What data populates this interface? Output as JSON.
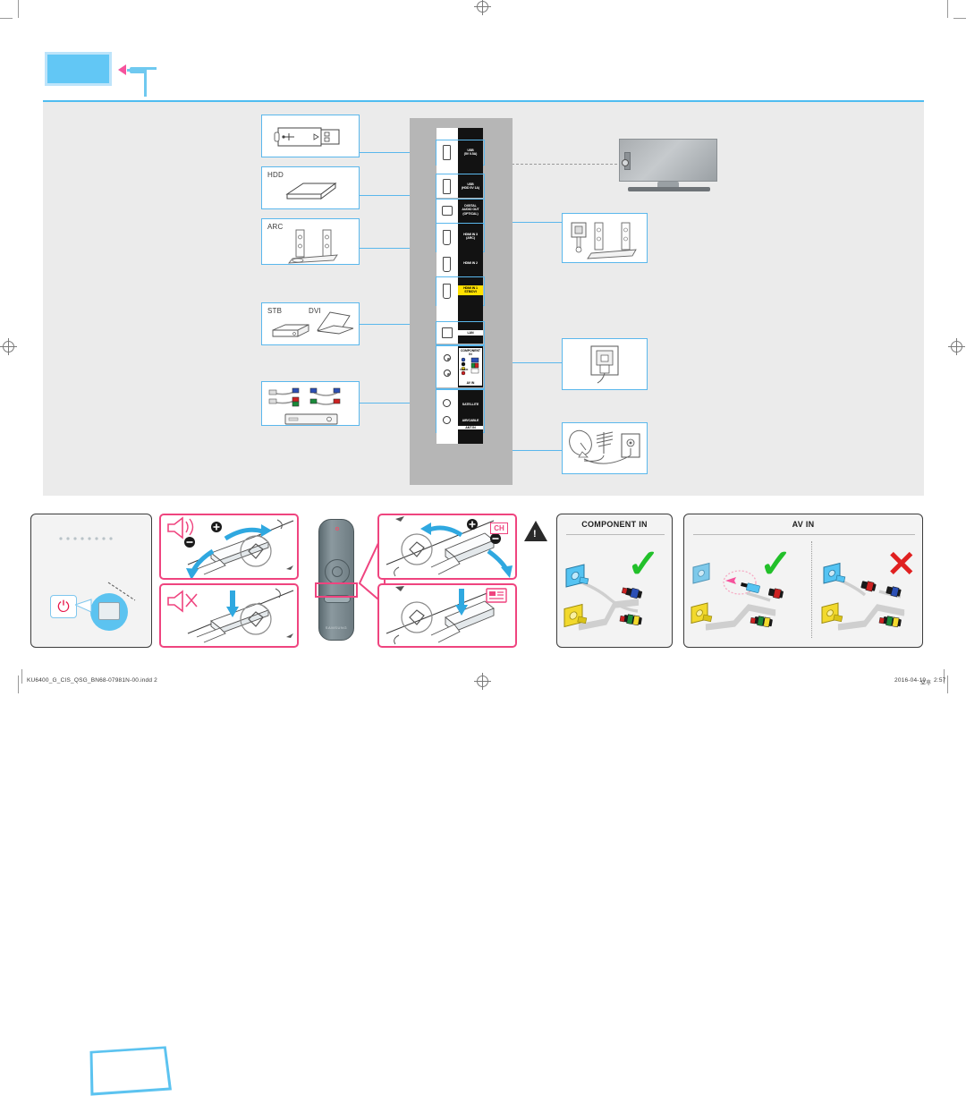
{
  "document": {
    "type": "tv-quick-setup-guide",
    "page_number": "2",
    "footer_filename": "KU6400_G_CIS_QSG_BN68-07981N-00.indd   2",
    "footer_date": "2016-04-19",
    "footer_time": "2:57",
    "footer_ampm": "오후"
  },
  "colors": {
    "accent_blue": "#5ab7ec",
    "screen_blue": "#62c7f5",
    "pink": "#ef447f",
    "pink_arrow": "#f6529c",
    "panel_grey": "#ebebeb",
    "port_strip_grey": "#b6b6b6",
    "check_green": "#22c02a",
    "cross_red": "#e02020",
    "highlight_yellow": "#ffe000",
    "power_red": "#e8174a"
  },
  "header": {
    "icon_tv": "tv-screen-icon",
    "icon_arrow": "pink-arrow-icon",
    "icon_plug": "power-plug-icon"
  },
  "devices": [
    {
      "label": "",
      "icon": "usb-flash-drive-icon",
      "name": "usb-device-box"
    },
    {
      "label": "HDD",
      "icon": "external-hard-drive-icon",
      "name": "hdd-device-box"
    },
    {
      "label": "ARC",
      "icon": "soundbar-speakers-icon",
      "name": "arc-device-box"
    },
    {
      "label": "STB",
      "label2": "DVI",
      "icon": "set-top-box-laptop-icon",
      "name": "stb-dvi-device-box"
    },
    {
      "label": "",
      "icon": "av-component-cables-dvd-icon",
      "name": "av-cables-device-box"
    }
  ],
  "ports": [
    {
      "id": "usb-hdd-5v-05a",
      "label": "USB ↑\n(5V 0.5A)",
      "line1": "USB",
      "line2": "(5V 0.5A)",
      "jack": "usb-port-icon",
      "highlighted": true
    },
    {
      "id": "usb-hdd-5v-1a",
      "label": "USB ↑\n(HDD 5V 1A)",
      "line1": "USB",
      "line2": "(HDD 5V 1A)",
      "jack": "usb-port-icon",
      "highlighted": true
    },
    {
      "id": "digital-audio-out",
      "line1": "DIGITAL",
      "line2": "AUDIO OUT",
      "line3": "(OPTICAL)",
      "jack": "optical-port-icon",
      "highlighted": true
    },
    {
      "id": "hdmi-in-3-arc",
      "line1": "HDMI IN 3",
      "line2": "(ARC)",
      "jack": "hdmi-port-icon",
      "highlighted": true
    },
    {
      "id": "hdmi-in-2",
      "line1": "HDMI IN 2",
      "jack": "hdmi-port-icon",
      "highlighted": false
    },
    {
      "id": "hdmi-in-1-stb-dvi",
      "line1": "HDMI IN 1",
      "line2": "STB/DVI",
      "jack": "hdmi-port-icon",
      "highlighted": true,
      "yellow": true
    },
    {
      "id": "lan",
      "line1": "LAN",
      "jack": "lan-port-icon",
      "highlighted": true,
      "inverted": true
    },
    {
      "id": "component-av-in",
      "line1": "COMPONENT",
      "line2": "IN",
      "line3": "VIDEO",
      "line4": "AV IN",
      "jack": "rca-jacks-icon",
      "highlighted": true
    },
    {
      "id": "ant-in",
      "line1": "SATELLITE",
      "line2": "AIR/CABLE",
      "line3": "ANT IN",
      "jack": "coax-jacks-icon",
      "highlighted": true
    }
  ],
  "targets": [
    {
      "id": "tv-rear",
      "name": "tv-rear-view",
      "label": ""
    },
    {
      "id": "audio-system",
      "name": "home-audio-system-box",
      "label": ""
    },
    {
      "id": "lan-wall",
      "name": "lan-wall-jack-box",
      "label": ""
    },
    {
      "id": "antenna",
      "name": "satellite-antenna-box",
      "label": ""
    }
  ],
  "bottom": {
    "power_panel": {
      "name": "power-button-panel",
      "icon_power": "power-icon",
      "icon_tv": "tv-front-icon",
      "icon_magnifier": "magnifier-icon"
    },
    "remote": {
      "name": "samsung-remote-control",
      "brand": "SAMSUNG",
      "highlight": "volume-channel-rocker"
    },
    "controls": [
      {
        "id": "volume-up-down",
        "icon": "speaker-volume-icon",
        "plus": "+",
        "minus": "−",
        "badge": ""
      },
      {
        "id": "mute",
        "icon": "speaker-mute-icon",
        "plus": "",
        "minus": "",
        "badge": ""
      },
      {
        "id": "channel-up-down",
        "icon": "",
        "plus": "+",
        "minus": "−",
        "badge": "CH"
      },
      {
        "id": "source-select",
        "icon": "",
        "plus": "",
        "minus": "",
        "badge": "source-icon"
      }
    ],
    "warning": {
      "name": "warning-triangle-icon",
      "glyph": "!"
    },
    "component_panel": {
      "title": "COMPONENT IN",
      "mark": "✓",
      "mark_type": "check"
    },
    "av_panel": {
      "title": "AV IN",
      "left_mark": "✓",
      "left_mark_type": "check",
      "right_mark": "✕",
      "right_mark_type": "cross"
    }
  }
}
